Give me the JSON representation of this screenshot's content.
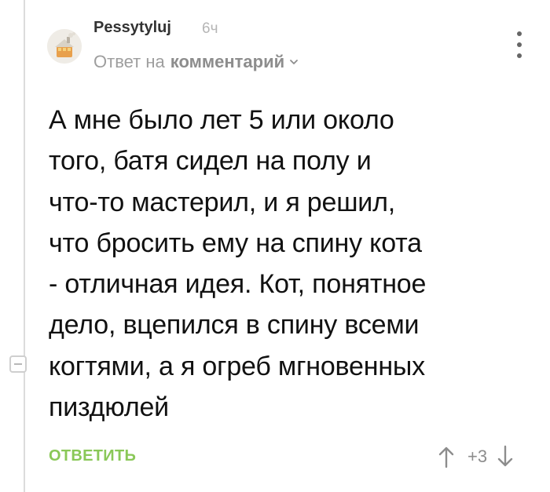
{
  "comment": {
    "author": "Pessytyluj",
    "time": "6ч",
    "reply_prefix": "Ответ на",
    "reply_target": "комментарий",
    "text": "А мне было лет 5 или около\nтого, батя сидел на полу и\nчто-то мастерил, и я решил,\nчто бросить ему на спину кота\n- отличная идея. Кот, понятное\nдело, вцепился в спину всеми\nкогтями, а я огреб мгновенных\nпиздюлей",
    "reply_label": "ОТВЕТИТЬ",
    "rating": "+3"
  },
  "icons": {
    "avatar": "avatar-icon",
    "menu": "more-vertical-icon",
    "chevron": "chevron-down-icon",
    "upvote": "arrow-up-icon",
    "downvote": "arrow-down-icon",
    "collapse": "minus-icon"
  },
  "colors": {
    "reply_accent": "#8ac858",
    "muted_text": "#9e9e9e",
    "thread_line": "#dcdcdc"
  }
}
